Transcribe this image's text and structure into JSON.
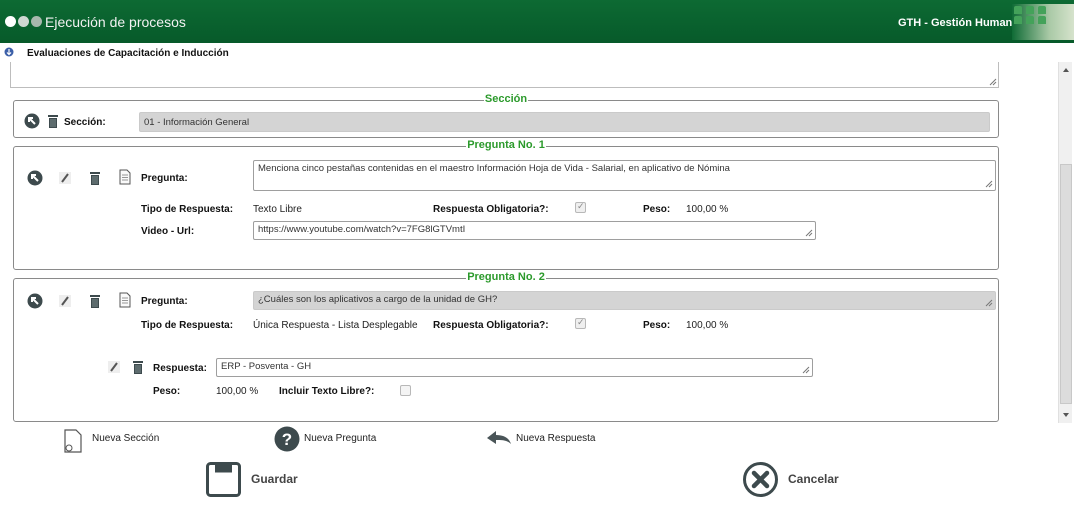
{
  "header": {
    "title": "Ejecución de procesos",
    "app_name": "GTH - Gestión Humana"
  },
  "page": {
    "subtitle": "Evaluaciones de Capacitación e Inducción"
  },
  "seccion": {
    "legend": "Sección",
    "label": "Sección:",
    "value": "01 - Información General"
  },
  "preguntas": [
    {
      "legend": "Pregunta No. 1",
      "pregunta_label": "Pregunta:",
      "pregunta_value": "Menciona cinco pestañas contenidas en el maestro Información Hoja de Vida - Salarial, en aplicativo de Nómina",
      "tipo_label": "Tipo de Respuesta:",
      "tipo_value": "Texto Libre",
      "obligatoria_label": "Respuesta Obligatoria?:",
      "obligatoria_checked": "✓",
      "peso_label": "Peso:",
      "peso_value": "100,00 %",
      "video_label": "Video - Url:",
      "video_value": "https://www.youtube.com/watch?v=7FG8lGTVmtI"
    },
    {
      "legend": "Pregunta No. 2",
      "pregunta_label": "Pregunta:",
      "pregunta_value": "¿Cuáles son los aplicativos a cargo de la unidad de GH?",
      "tipo_label": "Tipo de Respuesta:",
      "tipo_value": "Única Respuesta - Lista Desplegable",
      "obligatoria_label": "Respuesta Obligatoria?:",
      "obligatoria_checked": "✓",
      "peso_label": "Peso:",
      "peso_value": "100,00 %",
      "respuesta": {
        "label": "Respuesta:",
        "value": "ERP - Posventa - GH",
        "peso_label": "Peso:",
        "peso_value": "100,00 %",
        "texto_libre_label": "Incluir Texto Libre?:"
      }
    }
  ],
  "actions": {
    "nueva_seccion": "Nueva Sección",
    "nueva_pregunta": "Nueva Pregunta",
    "nueva_respuesta": "Nueva Respuesta",
    "guardar": "Guardar",
    "cancelar": "Cancelar"
  },
  "colors": {
    "header_green": "#0b6430",
    "legend_green": "#2c9a2c",
    "icon_dark": "#3d4a4d"
  }
}
